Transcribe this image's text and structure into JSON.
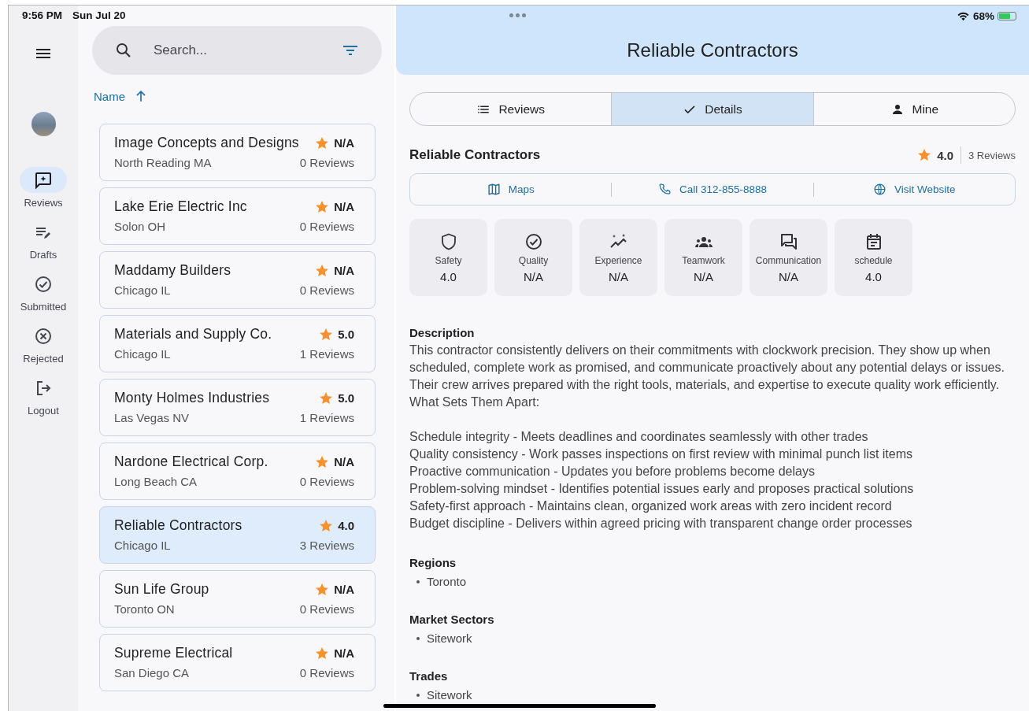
{
  "status_bar": {
    "time": "9:56 PM",
    "date": "Sun Jul 20",
    "battery": "68%"
  },
  "nav": {
    "items": [
      {
        "label": "Reviews",
        "selected": true
      },
      {
        "label": "Drafts",
        "selected": false
      },
      {
        "label": "Submitted",
        "selected": false
      },
      {
        "label": "Rejected",
        "selected": false
      },
      {
        "label": "Logout",
        "selected": false
      }
    ]
  },
  "search": {
    "placeholder": "Search..."
  },
  "sort": {
    "label": "Name"
  },
  "companies": [
    {
      "name": "Image Concepts and Designs",
      "location": "North Reading MA",
      "rating": "N/A",
      "reviews": "0 Reviews",
      "selected": false
    },
    {
      "name": "Lake Erie Electric Inc",
      "location": "Solon OH",
      "rating": "N/A",
      "reviews": "0 Reviews",
      "selected": false
    },
    {
      "name": "Maddamy Builders",
      "location": "Chicago IL",
      "rating": "N/A",
      "reviews": "0 Reviews",
      "selected": false
    },
    {
      "name": "Materials and Supply Co.",
      "location": "Chicago IL",
      "rating": "5.0",
      "reviews": "1 Reviews",
      "selected": false
    },
    {
      "name": "Monty Holmes Industries",
      "location": "Las Vegas NV",
      "rating": "5.0",
      "reviews": "1 Reviews",
      "selected": false
    },
    {
      "name": "Nardone Electrical Corp.",
      "location": "Long Beach CA",
      "rating": "N/A",
      "reviews": "0 Reviews",
      "selected": false
    },
    {
      "name": "Reliable Contractors",
      "location": "Chicago IL",
      "rating": "4.0",
      "reviews": "3 Reviews",
      "selected": true
    },
    {
      "name": "Sun Life Group",
      "location": "Toronto ON",
      "rating": "N/A",
      "reviews": "0 Reviews",
      "selected": false
    },
    {
      "name": "Supreme Electrical",
      "location": "San Diego CA",
      "rating": "N/A",
      "reviews": "0 Reviews",
      "selected": false
    }
  ],
  "detail": {
    "title": "Reliable Contractors",
    "tabs": [
      {
        "label": "Reviews",
        "selected": false
      },
      {
        "label": "Details",
        "selected": true
      },
      {
        "label": "Mine",
        "selected": false
      }
    ],
    "name": "Reliable Contractors",
    "rating": "4.0",
    "reviews": "3 Reviews",
    "actions": [
      "Maps",
      "Call 312-855-8888",
      "Visit Website"
    ],
    "metrics": [
      {
        "label": "Safety",
        "value": "4.0"
      },
      {
        "label": "Quality",
        "value": "N/A"
      },
      {
        "label": "Experience",
        "value": "N/A"
      },
      {
        "label": "Teamwork",
        "value": "N/A"
      },
      {
        "label": "Communication",
        "value": "N/A"
      },
      {
        "label": "schedule",
        "value": "4.0"
      }
    ],
    "description": {
      "heading": "Description",
      "text": "This contractor consistently delivers on their commitments with clockwork precision. They show up when scheduled, complete work as promised, and communicate proactively about any potential delays or issues. Their crew arrives prepared with the right tools, materials, and expertise to execute quality work efficiently.\nWhat Sets Them Apart:\n\nSchedule integrity - Meets deadlines and coordinates seamlessly with other trades\nQuality consistency - Work passes inspections on first review with minimal punch list items\nProactive communication - Updates you before problems become delays\nProblem-solving mindset - Identifies potential issues early and proposes practical solutions\nSafety-first approach - Maintains clean, organized work areas with zero incident record\nBudget discipline - Delivers within agreed pricing with transparent change order processes"
    },
    "sections": [
      {
        "heading": "Regions",
        "items": [
          "Toronto"
        ]
      },
      {
        "heading": "Market Sectors",
        "items": [
          "Sitework"
        ]
      },
      {
        "heading": "Trades",
        "items": [
          "Sitework"
        ]
      }
    ]
  }
}
